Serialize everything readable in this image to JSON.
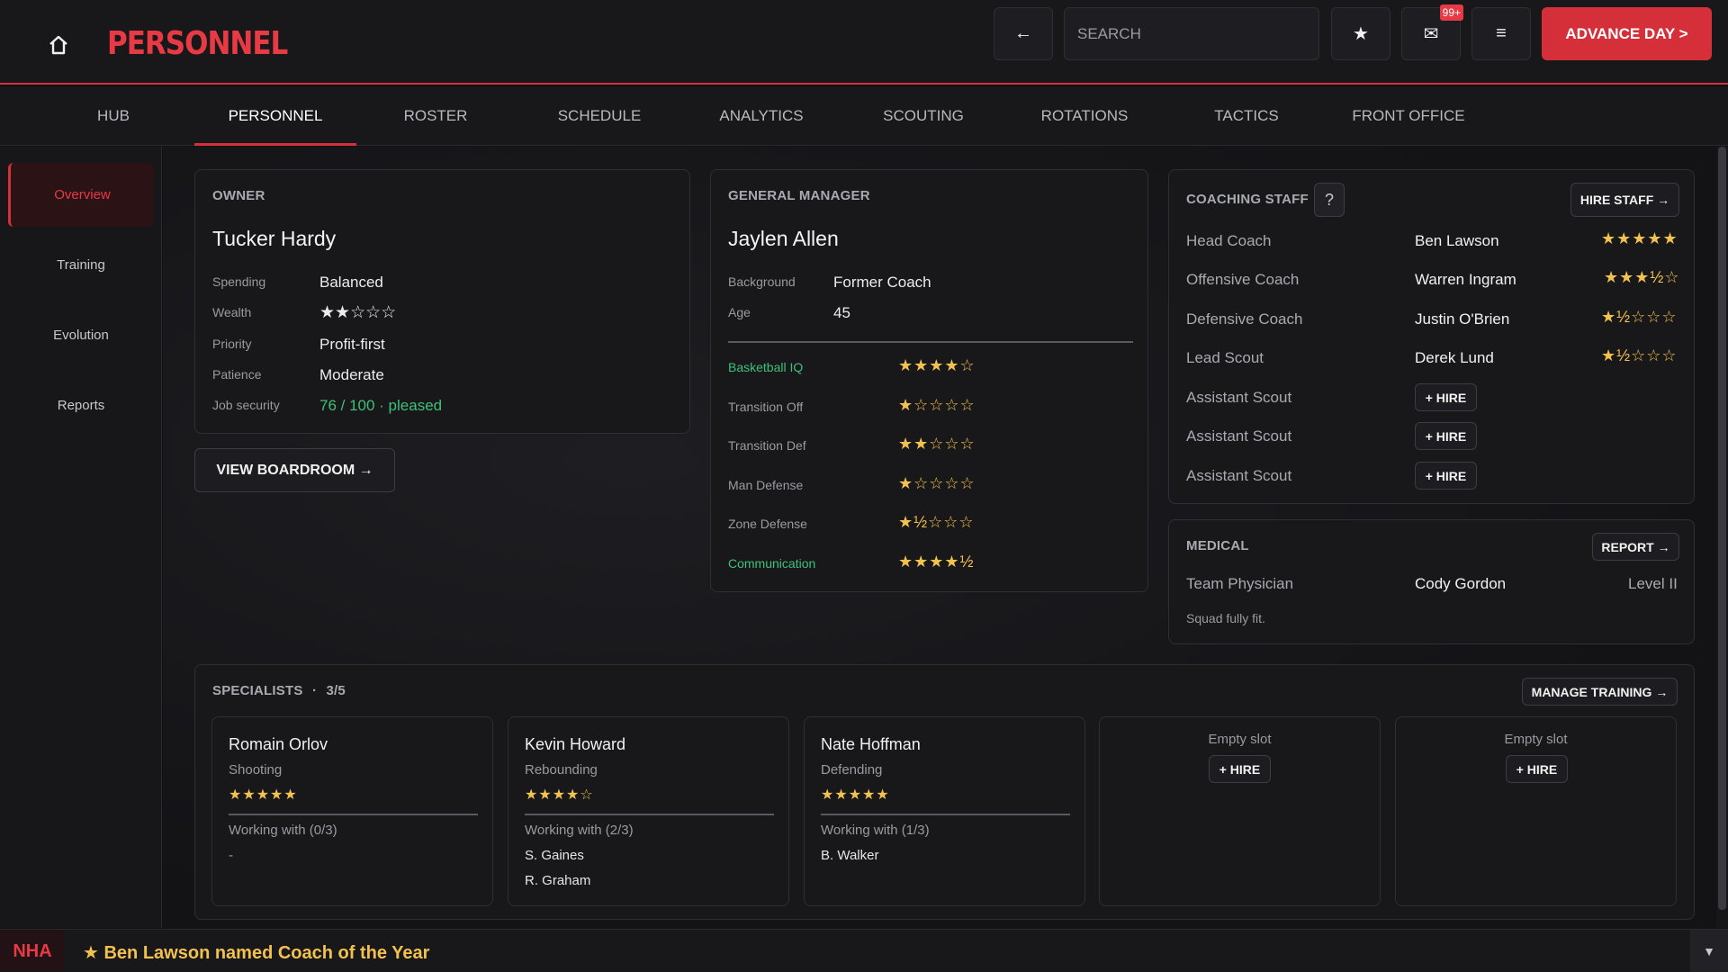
{
  "header": {
    "title": "PERSONNEL",
    "search_placeholder": "SEARCH",
    "mail_badge": "99+",
    "advance_label": "ADVANCE DAY >"
  },
  "tabs": [
    {
      "label": "HUB"
    },
    {
      "label": "PERSONNEL"
    },
    {
      "label": "ROSTER"
    },
    {
      "label": "SCHEDULE"
    },
    {
      "label": "ANALYTICS"
    },
    {
      "label": "SCOUTING"
    },
    {
      "label": "ROTATIONS"
    },
    {
      "label": "TACTICS"
    },
    {
      "label": "FRONT OFFICE"
    }
  ],
  "sidebar": {
    "items": [
      {
        "label": "Overview"
      },
      {
        "label": "Training"
      },
      {
        "label": "Evolution"
      },
      {
        "label": "Reports"
      }
    ]
  },
  "owner": {
    "title": "OWNER",
    "name": "Tucker Hardy",
    "rows": [
      {
        "label": "Spending",
        "value": "Balanced"
      },
      {
        "label": "Wealth",
        "value": "★★☆☆☆"
      },
      {
        "label": "Priority",
        "value": "Profit-first"
      },
      {
        "label": "Patience",
        "value": "Moderate"
      },
      {
        "label": "Job security",
        "value": "76 / 100 · pleased"
      }
    ],
    "boardroom_label": "VIEW BOARDROOM →"
  },
  "gm": {
    "title": "GENERAL MANAGER",
    "name": "Jaylen Allen",
    "rows": [
      {
        "label": "Background",
        "value": "Former Coach"
      },
      {
        "label": "Age",
        "value": "45"
      }
    ],
    "skills": [
      {
        "label": "Basketball IQ",
        "stars": "★★★★☆",
        "highlight": true
      },
      {
        "label": "Transition Off",
        "stars": "★☆☆☆☆",
        "highlight": false
      },
      {
        "label": "Transition Def",
        "stars": "★★☆☆☆",
        "highlight": false
      },
      {
        "label": "Man Defense",
        "stars": "★☆☆☆☆",
        "highlight": false
      },
      {
        "label": "Zone Defense",
        "stars": "★½☆☆☆",
        "highlight": false
      },
      {
        "label": "Communication",
        "stars": "★★★★½",
        "highlight": true
      }
    ]
  },
  "coaching": {
    "title": "COACHING STAFF",
    "help": "?",
    "hire_staff_label": "HIRE STAFF →",
    "hire_label": "+ HIRE",
    "staff": [
      {
        "role": "Head Coach",
        "name": "Ben Lawson",
        "stars": "★★★★★"
      },
      {
        "role": "Offensive Coach",
        "name": "Warren Ingram",
        "stars": "★★★½☆"
      },
      {
        "role": "Defensive Coach",
        "name": "Justin O'Brien",
        "stars": "★½☆☆☆"
      },
      {
        "role": "Lead Scout",
        "name": "Derek Lund",
        "stars": "★½☆☆☆"
      },
      {
        "role": "Assistant Scout",
        "name": "",
        "stars": ""
      },
      {
        "role": "Assistant Scout",
        "name": "",
        "stars": ""
      },
      {
        "role": "Assistant Scout",
        "name": "",
        "stars": ""
      }
    ]
  },
  "medical": {
    "title": "MEDICAL",
    "report_label": "REPORT →",
    "role": "Team Physician",
    "name": "Cody Gordon",
    "level": "Level II",
    "status": "Squad fully fit."
  },
  "specialists": {
    "title": "SPECIALISTS",
    "count": "3/5",
    "manage_label": "MANAGE TRAINING →",
    "hire_label": "+ HIRE",
    "empty_label": "Empty slot",
    "cards": [
      {
        "name": "Romain Orlov",
        "skill": "Shooting",
        "stars": "★★★★★",
        "working": "Working with (0/3)",
        "players": [
          "-"
        ]
      },
      {
        "name": "Kevin Howard",
        "skill": "Rebounding",
        "stars": "★★★★☆",
        "working": "Working with (2/3)",
        "players": [
          "S. Gaines",
          "R. Graham"
        ]
      },
      {
        "name": "Nate Hoffman",
        "skill": "Defending",
        "stars": "★★★★★",
        "working": "Working with (1/3)",
        "players": [
          "B. Walker"
        ]
      }
    ]
  },
  "ticker": {
    "tag": "NHA",
    "text": "★ Ben Lawson named Coach of the Year"
  },
  "colors": {
    "accent": "#d5303a",
    "star": "#f2c14e",
    "positive": "#3ec07a",
    "background": "#121215"
  }
}
